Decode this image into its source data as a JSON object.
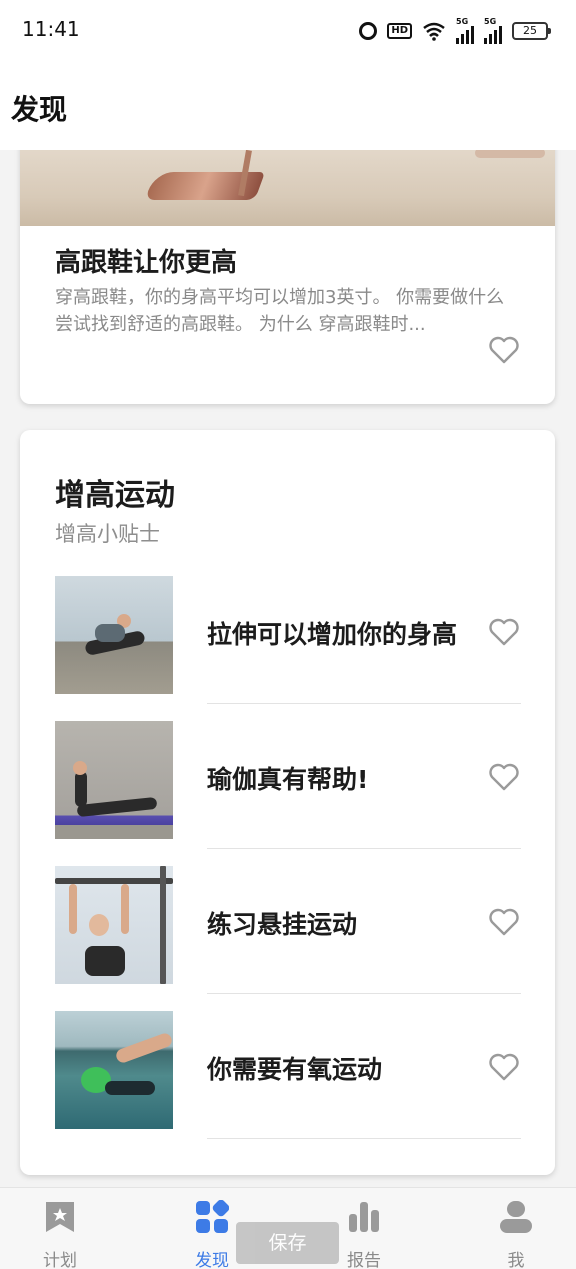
{
  "status_bar": {
    "time": "11:41",
    "net_label_1": "5G",
    "net_label_2": "5G",
    "hd_label": "HD",
    "battery": "25"
  },
  "header": {
    "title": "发现"
  },
  "article_card": {
    "title": "高跟鞋让你更高",
    "description": "穿高跟鞋，你的身高平均可以增加3英寸。 你需要做什么 尝试找到舒适的高跟鞋。 为什么 穿高跟鞋时..."
  },
  "section": {
    "title": "增高运动",
    "subtitle": "增高小贴士",
    "items": [
      {
        "label": "拉伸可以增加你的身高",
        "image": "stretching-photo"
      },
      {
        "label": "瑜伽真有帮助!",
        "image": "yoga-photo"
      },
      {
        "label": "练习悬挂运动",
        "image": "hanging-photo"
      },
      {
        "label": "你需要有氧运动",
        "image": "swimming-photo"
      }
    ]
  },
  "tabbar": {
    "tabs": [
      {
        "label": "计划",
        "icon": "bookmark-star-icon"
      },
      {
        "label": "发现",
        "icon": "grid-icon",
        "active": true
      },
      {
        "label": "报告",
        "icon": "bar-chart-icon"
      },
      {
        "label": "我",
        "icon": "user-icon"
      }
    ],
    "save_label": "保存"
  },
  "colors": {
    "accent": "#3d7be6",
    "inactive": "#9a9a9a",
    "heart": "#9a9a9a"
  }
}
